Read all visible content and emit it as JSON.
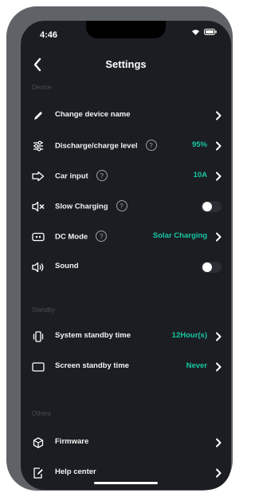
{
  "status_bar": {
    "time": "4:46"
  },
  "nav": {
    "title": "Settings"
  },
  "sections": {
    "device": "Device",
    "standby": "Standby",
    "others": "Others"
  },
  "rows": {
    "change_name": {
      "label": "Change device name"
    },
    "discharge": {
      "label": "Discharge/charge level",
      "value": "95%"
    },
    "car_input": {
      "label": "Car input",
      "value": "10A"
    },
    "slow_charging": {
      "label": "Slow Charging",
      "toggle": false
    },
    "dc_mode": {
      "label": "DC Mode",
      "value": "Solar Charging"
    },
    "sound": {
      "label": "Sound",
      "toggle": false
    },
    "system_standby": {
      "label": "System standby time",
      "value": "12Hour(s)"
    },
    "screen_standby": {
      "label": "Screen standby time",
      "value": "Never"
    },
    "firmware": {
      "label": "Firmware"
    },
    "help_center": {
      "label": "Help center"
    }
  },
  "help_glyph": "?",
  "colors": {
    "accent": "#16c7a3",
    "background": "#1b1d22",
    "frame": "#5f6368"
  }
}
